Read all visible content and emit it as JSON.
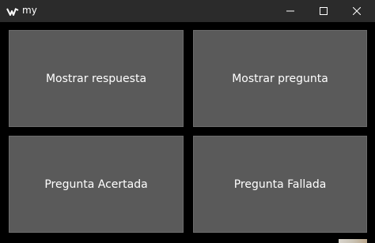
{
  "window": {
    "title": "my",
    "app_icon": "kivy-icon",
    "controls": {
      "minimize_icon": "minimize-icon",
      "maximize_icon": "maximize-icon",
      "close_icon": "close-icon"
    }
  },
  "buttons": {
    "show_answer": "Mostrar respuesta",
    "show_question": "Mostrar pregunta",
    "question_correct": "Pregunta Acertada",
    "question_failed": "Pregunta Fallada"
  },
  "colors": {
    "titlebar": "#2b2b2b",
    "background": "#000000",
    "button": "#5a5a5a",
    "text": "#ffffff"
  }
}
